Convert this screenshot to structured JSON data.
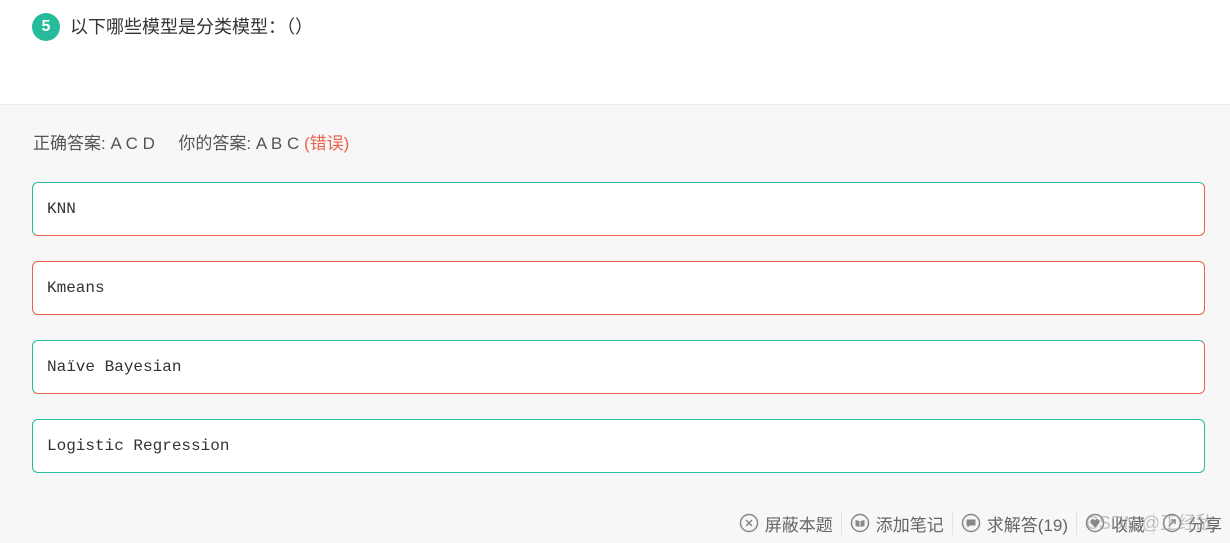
{
  "question": {
    "number": "5",
    "text": "以下哪些模型是分类模型：（）"
  },
  "answer": {
    "correct_label": "正确答案:",
    "correct_value": "A C D",
    "yours_label": "你的答案:",
    "yours_value": "A B C",
    "status": "(错误)"
  },
  "options": [
    {
      "text": "KNN"
    },
    {
      "text": "Kmeans"
    },
    {
      "text": "Naïve Bayesian"
    },
    {
      "text": "Logistic Regression"
    }
  ],
  "toolbar": {
    "block_label": "屏蔽本题",
    "note_label": "添加笔记",
    "ask_label": "求解答(19)",
    "fav_label": "收藏",
    "share_label": "分享"
  },
  "watermark": "CSDN @正经敌",
  "colors": {
    "accent": "#25bb9b",
    "error": "#e8624e"
  }
}
